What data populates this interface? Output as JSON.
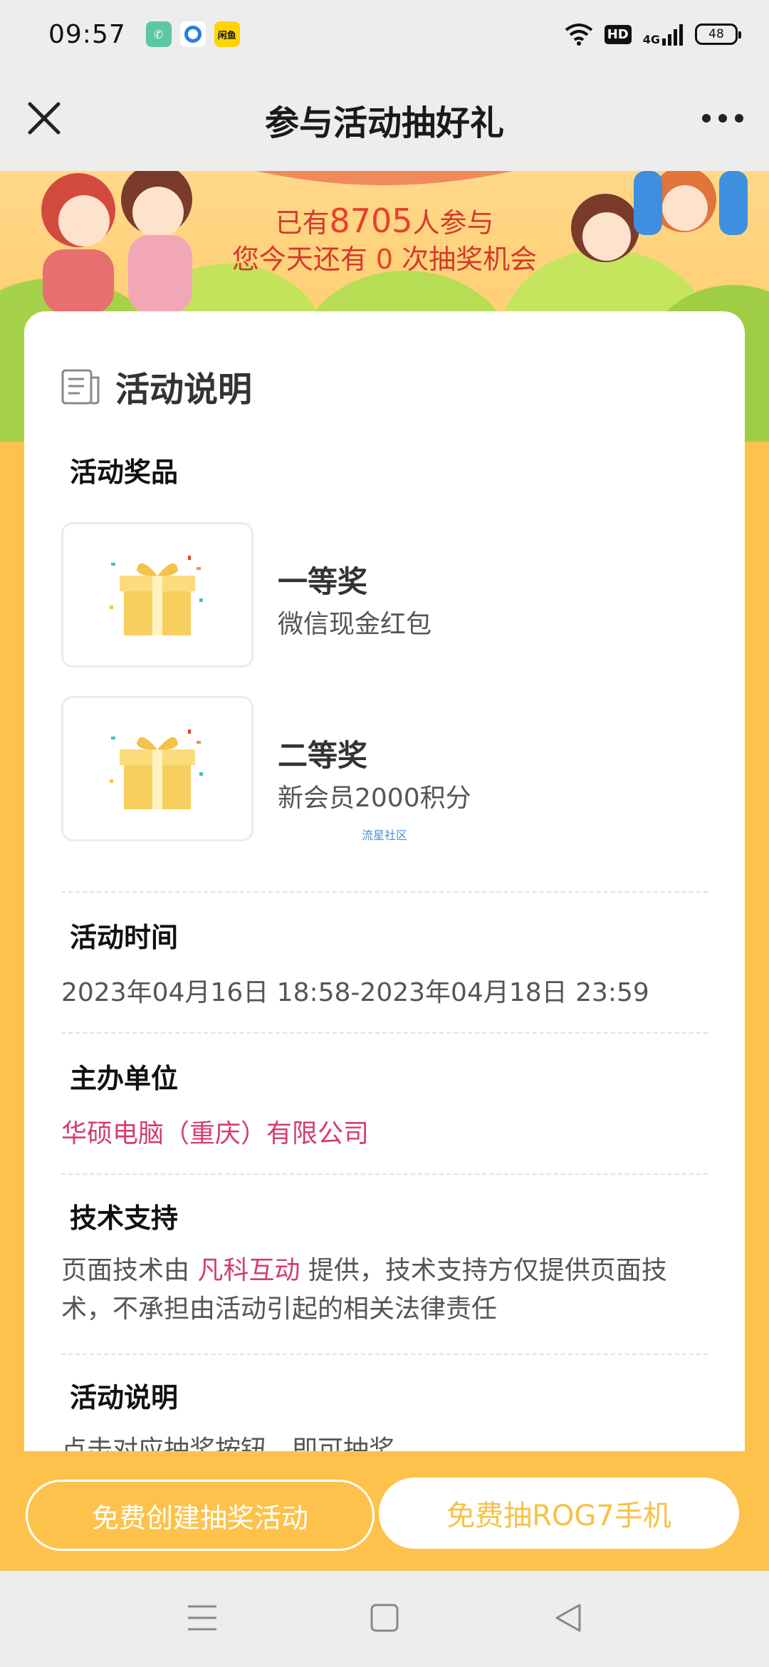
{
  "status": {
    "time": "09:57",
    "hd": "HD",
    "network": "4G",
    "battery": "48",
    "app_icons": [
      "phone-app-icon",
      "browser-app-icon",
      "xianyu-app-icon"
    ],
    "xianyu_label": "闲鱼"
  },
  "nav": {
    "title": "参与活动抽好礼"
  },
  "banner": {
    "prefix": "已有",
    "count": "8705",
    "suffix": "人参与",
    "chances_prefix": "您今天还有 ",
    "chances": "0",
    "chances_suffix": " 次抽奖机会"
  },
  "card": {
    "title": "活动说明",
    "prizes_label": "活动奖品",
    "prizes": [
      {
        "rank": "一等奖",
        "desc": "微信现金红包"
      },
      {
        "rank": "二等奖",
        "desc": "新会员2000积分"
      }
    ],
    "watermark": "流星社区",
    "time_label": "活动时间",
    "time_value": "2023年04月16日 18:58-2023年04月18日 23:59",
    "organizer_label": "主办单位",
    "organizer_value": "华硕电脑（重庆）有限公司",
    "support_label": "技术支持",
    "support_prefix": "页面技术由 ",
    "support_company": "凡科互动",
    "support_suffix": " 提供，技术支持方仅提供页面技术，不承担由活动引起的相关法律责任",
    "desc_label": "活动说明",
    "desc_value": "点击对应抽奖按钮，即可抽奖"
  },
  "actions": {
    "create": "免费创建抽奖活动",
    "draw": "免费抽ROG7手机"
  },
  "colors": {
    "accent": "#fdc24b",
    "highlight_red": "#e5412f",
    "pink": "#d23e6c"
  }
}
